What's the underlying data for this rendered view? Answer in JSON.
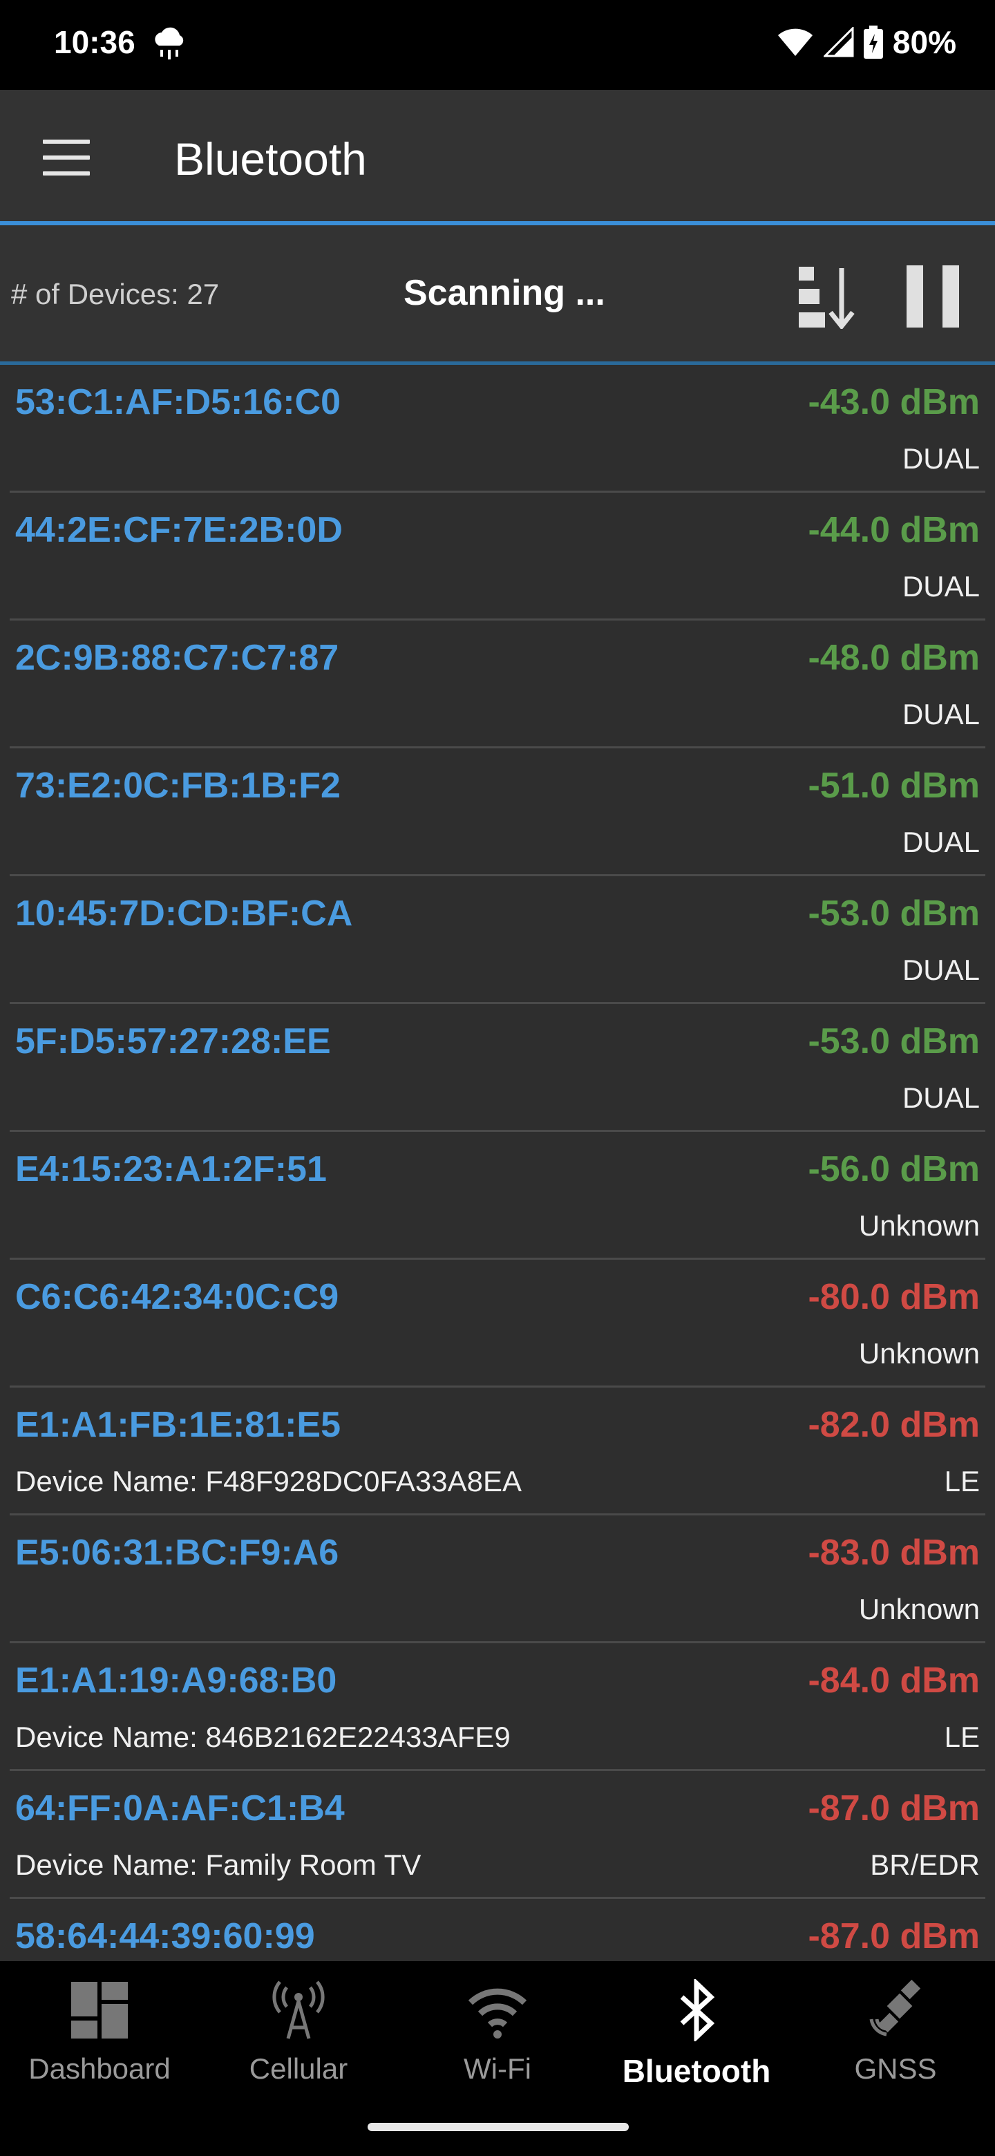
{
  "status_bar": {
    "time": "10:36",
    "weather_icon": "cloud-rain-icon",
    "battery_percent": "80%"
  },
  "app_bar": {
    "title": "Bluetooth"
  },
  "toolbar": {
    "device_count": "# of Devices: 27",
    "scan_status": "Scanning ..."
  },
  "devices": [
    {
      "mac": "53:C1:AF:D5:16:C0",
      "rssi": "-43.0 dBm",
      "rssi_level": "good",
      "name": "",
      "type": "DUAL"
    },
    {
      "mac": "44:2E:CF:7E:2B:0D",
      "rssi": "-44.0 dBm",
      "rssi_level": "good",
      "name": "",
      "type": "DUAL"
    },
    {
      "mac": "2C:9B:88:C7:C7:87",
      "rssi": "-48.0 dBm",
      "rssi_level": "good",
      "name": "",
      "type": "DUAL"
    },
    {
      "mac": "73:E2:0C:FB:1B:F2",
      "rssi": "-51.0 dBm",
      "rssi_level": "good",
      "name": "",
      "type": "DUAL"
    },
    {
      "mac": "10:45:7D:CD:BF:CA",
      "rssi": "-53.0 dBm",
      "rssi_level": "good",
      "name": "",
      "type": "DUAL"
    },
    {
      "mac": "5F:D5:57:27:28:EE",
      "rssi": "-53.0 dBm",
      "rssi_level": "good",
      "name": "",
      "type": "DUAL"
    },
    {
      "mac": "E4:15:23:A1:2F:51",
      "rssi": "-56.0 dBm",
      "rssi_level": "good",
      "name": "",
      "type": "Unknown"
    },
    {
      "mac": "C6:C6:42:34:0C:C9",
      "rssi": "-80.0 dBm",
      "rssi_level": "bad",
      "name": "",
      "type": "Unknown"
    },
    {
      "mac": "E1:A1:FB:1E:81:E5",
      "rssi": "-82.0 dBm",
      "rssi_level": "bad",
      "name": "Device Name: F48F928DC0FA33A8EA",
      "type": "LE"
    },
    {
      "mac": "E5:06:31:BC:F9:A6",
      "rssi": "-83.0 dBm",
      "rssi_level": "bad",
      "name": "",
      "type": "Unknown"
    },
    {
      "mac": "E1:A1:19:A9:68:B0",
      "rssi": "-84.0 dBm",
      "rssi_level": "bad",
      "name": "Device Name: 846B2162E22433AFE9",
      "type": "LE"
    },
    {
      "mac": "64:FF:0A:AF:C1:B4",
      "rssi": "-87.0 dBm",
      "rssi_level": "bad",
      "name": "Device Name: Family Room TV",
      "type": "BR/EDR"
    },
    {
      "mac": "58:64:44:39:60:99",
      "rssi": "-87.0 dBm",
      "rssi_level": "bad",
      "name": "",
      "type": ""
    }
  ],
  "colors": {
    "good": "#5a9c4a",
    "bad": "#d04a44",
    "mac": "#4a9be0",
    "accent": "#3b8fd8"
  },
  "bottom_nav": {
    "items": [
      {
        "label": "Dashboard",
        "icon": "dashboard-icon",
        "active": false
      },
      {
        "label": "Cellular",
        "icon": "cell-tower-icon",
        "active": false
      },
      {
        "label": "Wi-Fi",
        "icon": "wifi-icon",
        "active": false
      },
      {
        "label": "Bluetooth",
        "icon": "bluetooth-icon",
        "active": true
      },
      {
        "label": "GNSS",
        "icon": "satellite-icon",
        "active": false
      }
    ]
  }
}
